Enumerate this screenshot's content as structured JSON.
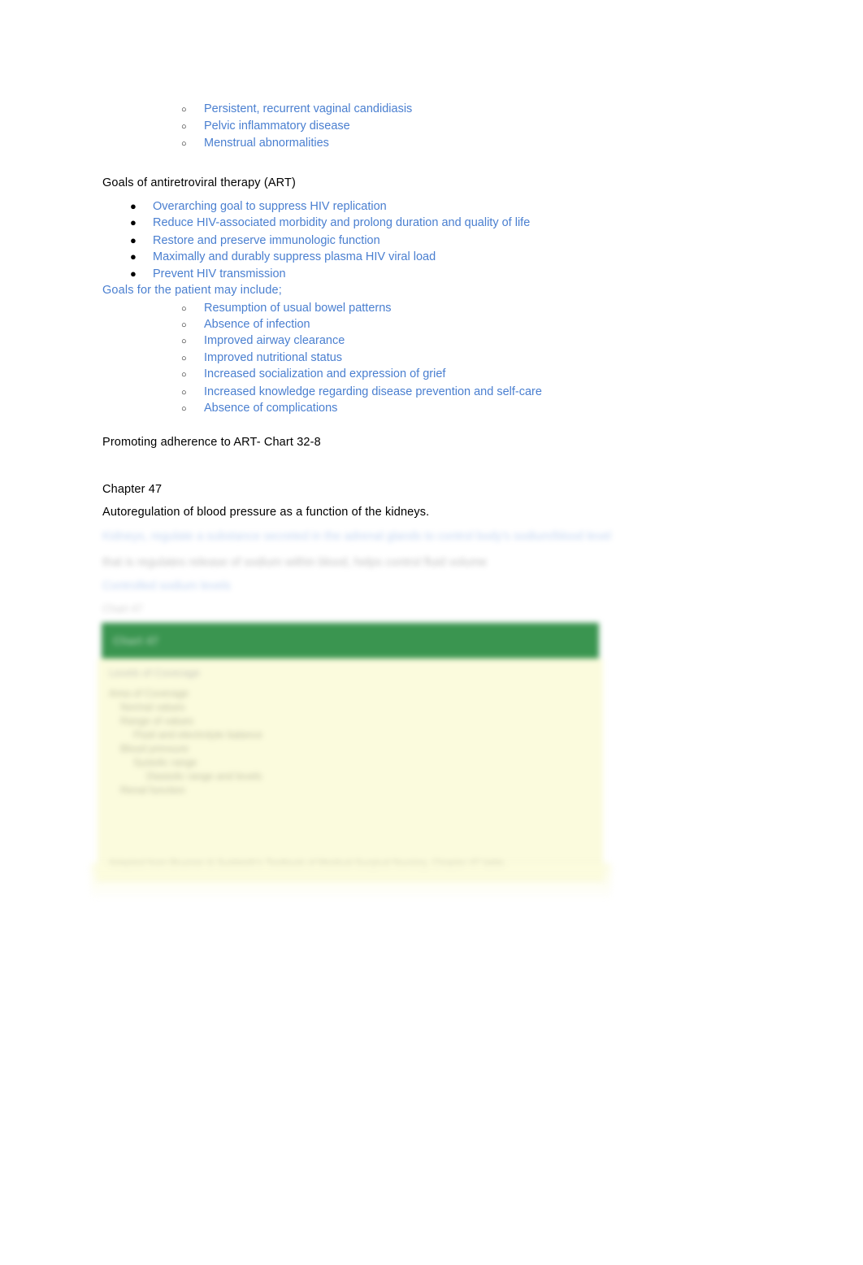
{
  "document": {
    "type": "study-notes",
    "colors": {
      "link_blue": "#4a7fd0",
      "body_text": "#000000",
      "infobox_header_green": "#3a9550",
      "infobox_body_cream": "#fbfbdd",
      "page_background": "#ffffff"
    }
  },
  "top_sublist": {
    "bullet_glyph": "circle-hollow",
    "items": [
      "Persistent, recurrent vaginal candidiasis",
      "Pelvic inflammatory disease",
      "Menstrual abnormalities"
    ]
  },
  "art_section": {
    "heading": "Goals of antiretroviral therapy (ART)",
    "bullet_glyph": "disc-filled",
    "goals": [
      "Overarching goal to suppress HIV replication",
      "Reduce HIV-associated morbidity and prolong duration and quality of life",
      "Restore and preserve immunologic function",
      "Maximally and durably suppress plasma HIV viral load",
      "Prevent HIV transmission"
    ],
    "patient_goals_intro": "Goals for the patient may include;",
    "patient_goals_bullet_glyph": "circle-hollow",
    "patient_goals": [
      "Resumption of usual bowel patterns",
      "Absence of infection",
      "Improved airway clearance",
      "Improved nutritional status",
      "Increased socialization and expression of grief",
      "Increased knowledge regarding disease prevention and self-care",
      "Absence of complications"
    ],
    "adherence_note": "Promoting adherence to ART- Chart 32-8"
  },
  "chapter_47": {
    "heading": "Chapter 47",
    "topic": "Autoregulation of blood pressure as a function of the kidneys.",
    "blurred_region_note": "illegible",
    "blurred_lines": [
      {
        "style": "blue",
        "text": "Kidneys, regulate a substance secreted in the adrenal glands to control body's sodium/blood level"
      },
      {
        "style": "grey",
        "text": "that is regulates release of sodium within blood, helps control fluid volume"
      },
      {
        "style": "blue",
        "text": "Controlled sodium levels"
      },
      {
        "style": "small",
        "text": "Chart 47"
      }
    ]
  },
  "infobox": {
    "header_title": "Chart 47",
    "subtitle": "Levels of Coverage",
    "lines": [
      {
        "indent": 0,
        "text": "Area of Coverage"
      },
      {
        "indent": 1,
        "text": "Normal values"
      },
      {
        "indent": 1,
        "text": "Range of values"
      },
      {
        "indent": 2,
        "text": "Fluid and electrolyte balance"
      },
      {
        "indent": 1,
        "text": "Blood pressure"
      },
      {
        "indent": 2,
        "text": "Systolic range"
      },
      {
        "indent": 3,
        "text": "Diastolic range and levels"
      },
      {
        "indent": 1,
        "text": "Renal function"
      }
    ],
    "footer_source": "Adapted from Brunner & Suddarth's Textbook of Medical-Surgical Nursing, Chapter 47 table."
  }
}
